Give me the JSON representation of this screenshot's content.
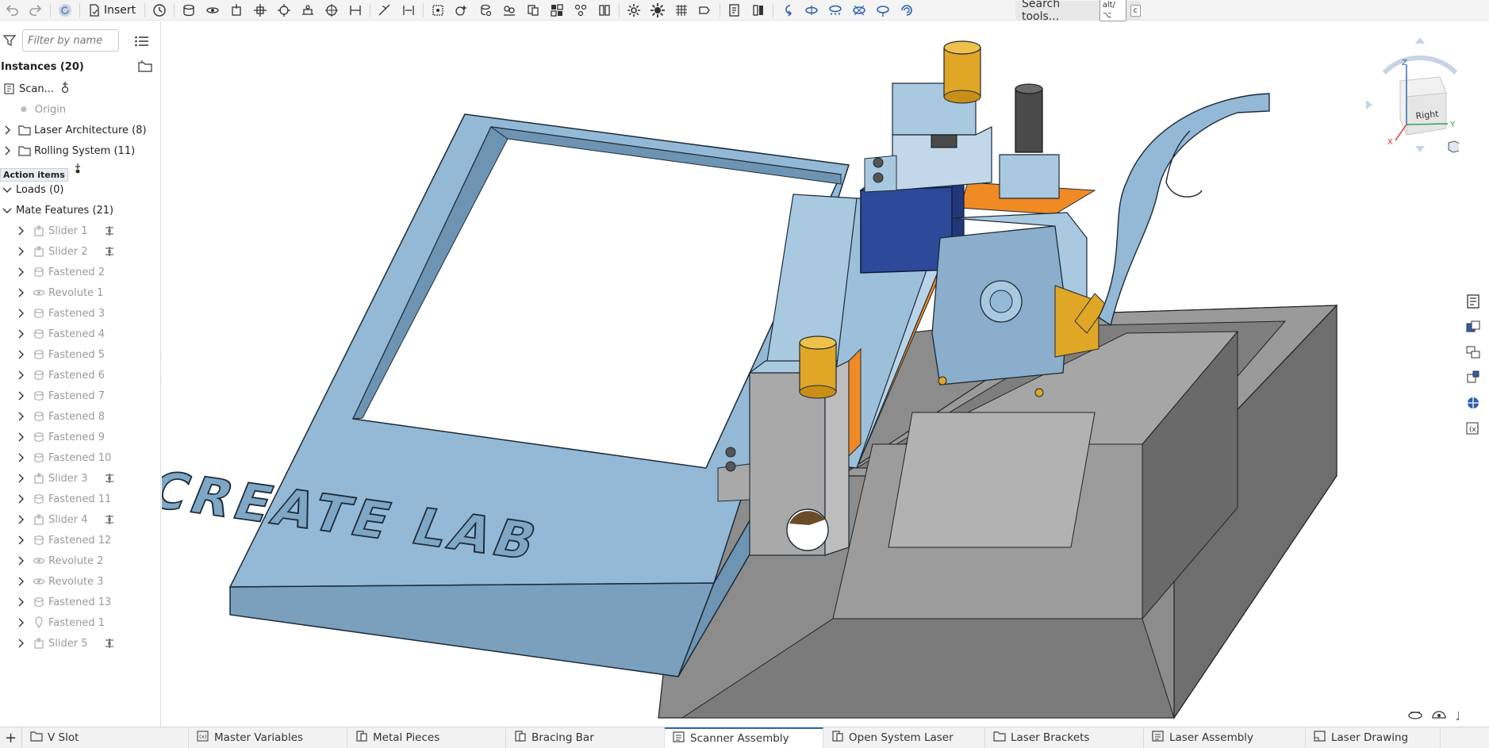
{
  "toolbar": {
    "insert_label": "Insert",
    "search_label": "Search tools...",
    "search_kbd_1": "alt/⌥",
    "search_kbd_2": "c"
  },
  "left_panel": {
    "filter_placeholder": "Filter by name",
    "instances_header": "Instances (20)",
    "items": [
      {
        "label": "Scan...",
        "kind": "part-studio"
      },
      {
        "label": "Origin",
        "kind": "origin"
      },
      {
        "label": "Laser Architecture (8)",
        "kind": "folder"
      },
      {
        "label": "Rolling System (11)",
        "kind": "folder"
      }
    ],
    "tooltip": "Action items",
    "loads": "Loads (0)",
    "mate_features": "Mate Features (21)",
    "mates": [
      {
        "label": "Slider 1",
        "type": "slider"
      },
      {
        "label": "Slider 2",
        "type": "slider"
      },
      {
        "label": "Fastened 2",
        "type": "fastened"
      },
      {
        "label": "Revolute 1",
        "type": "revolute"
      },
      {
        "label": "Fastened 3",
        "type": "fastened"
      },
      {
        "label": "Fastened 4",
        "type": "fastened"
      },
      {
        "label": "Fastened 5",
        "type": "fastened"
      },
      {
        "label": "Fastened 6",
        "type": "fastened"
      },
      {
        "label": "Fastened 7",
        "type": "fastened"
      },
      {
        "label": "Fastened 8",
        "type": "fastened"
      },
      {
        "label": "Fastened 9",
        "type": "fastened"
      },
      {
        "label": "Fastened 10",
        "type": "fastened"
      },
      {
        "label": "Slider 3",
        "type": "slider"
      },
      {
        "label": "Fastened 11",
        "type": "fastened"
      },
      {
        "label": "Slider 4",
        "type": "slider"
      },
      {
        "label": "Fastened 12",
        "type": "fastened"
      },
      {
        "label": "Revolute 2",
        "type": "revolute"
      },
      {
        "label": "Revolute 3",
        "type": "revolute"
      },
      {
        "label": "Fastened 13",
        "type": "fastened"
      },
      {
        "label": "Fastened 1",
        "type": "fastened-pin"
      },
      {
        "label": "Slider 5",
        "type": "slider"
      }
    ]
  },
  "viewport": {
    "embossed_text": "CREATE LAB",
    "viewcube": {
      "face": "Right",
      "axis_z": "Z",
      "axis_y": "Y",
      "axis_x": "X"
    }
  },
  "tabs": [
    {
      "label": "V Slot",
      "icon": "folder-icon"
    },
    {
      "label": "Master Variables",
      "icon": "variable-studio-icon"
    },
    {
      "label": "Metal Pieces",
      "icon": "part-studio-icon"
    },
    {
      "label": "Bracing Bar",
      "icon": "part-studio-icon"
    },
    {
      "label": "Scanner Assembly",
      "icon": "assembly-icon",
      "active": true
    },
    {
      "label": "Open System Laser",
      "icon": "part-studio-icon"
    },
    {
      "label": "Laser Brackets",
      "icon": "folder-icon"
    },
    {
      "label": "Laser Assembly",
      "icon": "assembly-icon"
    },
    {
      "label": "Laser Drawing",
      "icon": "drawing-icon"
    }
  ],
  "colors": {
    "part_blue": "#8fb6d3",
    "part_blue_dark": "#6e97b6",
    "navy": "#2d4a9a",
    "gold": "#e0a626",
    "orange": "#f08a24",
    "gray_base": "#8a8a8a",
    "active_tab": "#2b6cb0"
  }
}
